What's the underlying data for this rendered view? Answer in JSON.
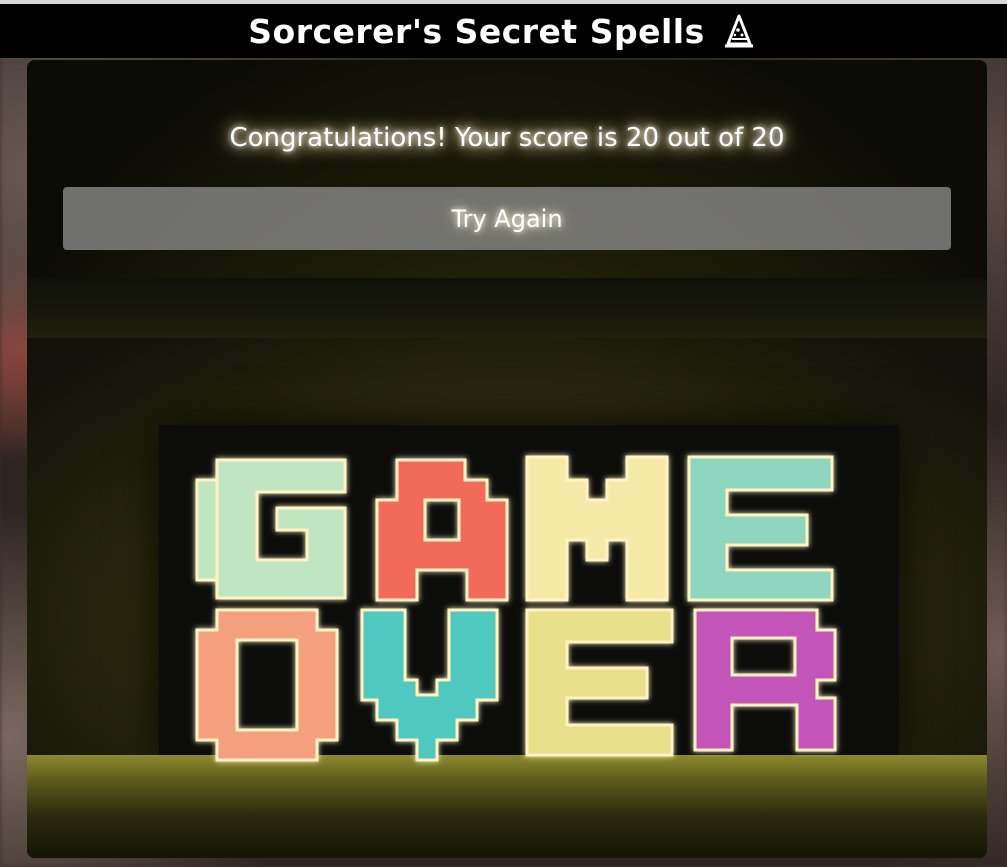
{
  "header": {
    "title": "Sorcerer's Secret Spells",
    "icon": "wizard-hat-icon"
  },
  "result": {
    "message": "Congratulations! Your score is 20 out of 20"
  },
  "actions": {
    "try_again_label": "Try Again"
  },
  "scene": {
    "sign_text_line1": "GAME",
    "sign_text_line2": "OVER",
    "letter_colors": {
      "G": "#bfe6c0",
      "A": "#f26a5a",
      "M": "#f6e9a8",
      "E1": "#8fd6c0",
      "O": "#f4a07e",
      "V": "#4fc8c0",
      "E2": "#e8e08a",
      "R": "#c354b8"
    }
  }
}
